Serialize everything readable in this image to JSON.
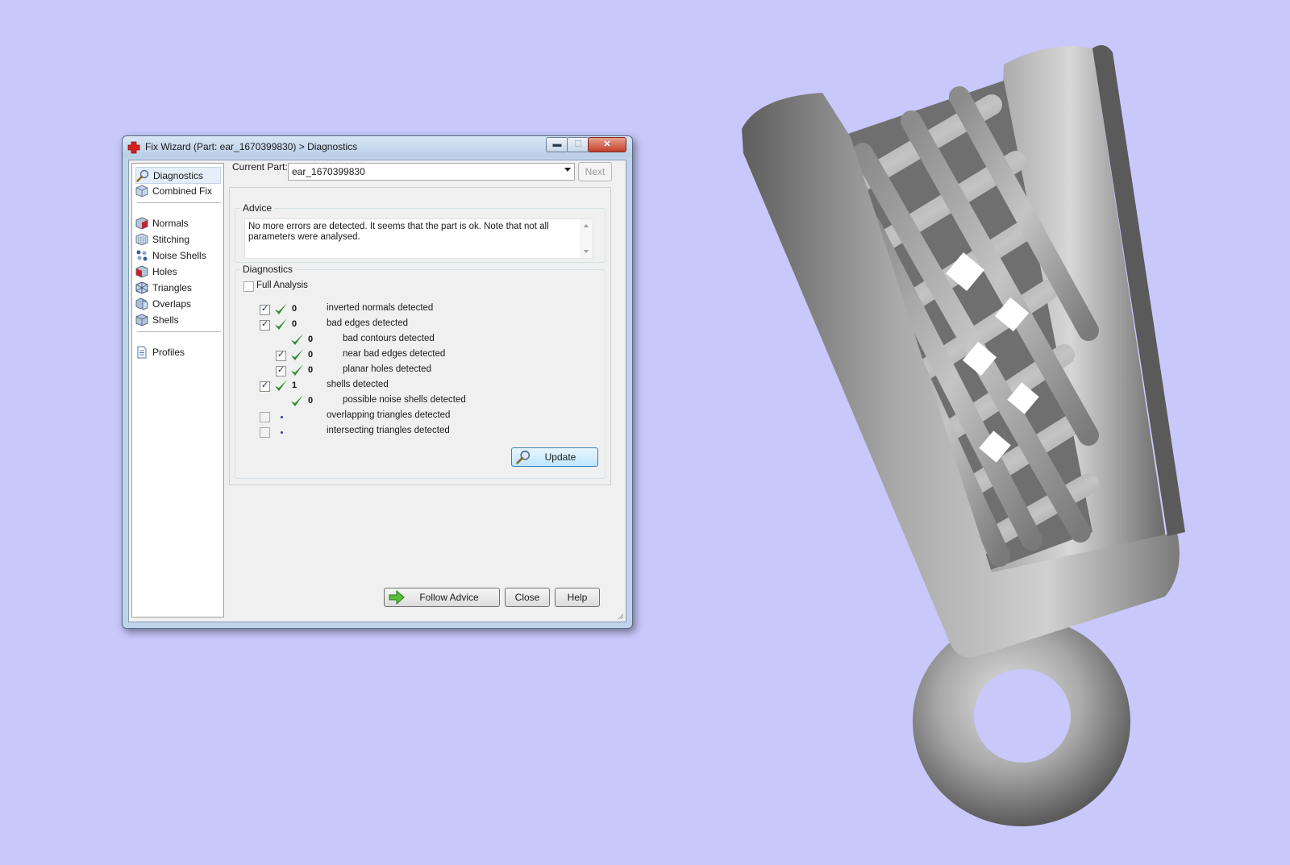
{
  "window": {
    "title": "Fix Wizard (Part: ear_1670399830) > Diagnostics",
    "minimize_glyph": "▬",
    "maximize_glyph": "☐",
    "close_glyph": "✕"
  },
  "sidebar": {
    "items": [
      {
        "label": "Diagnostics",
        "icon": "magnifier-icon",
        "selected": true
      },
      {
        "label": "Combined Fix",
        "icon": "cube-icon"
      },
      {
        "label": "Normals",
        "icon": "normals-cube-icon"
      },
      {
        "label": "Stitching",
        "icon": "stitching-cube-icon"
      },
      {
        "label": "Noise Shells",
        "icon": "noise-shells-icon"
      },
      {
        "label": "Holes",
        "icon": "holes-cube-icon"
      },
      {
        "label": "Triangles",
        "icon": "triangles-cube-icon"
      },
      {
        "label": "Overlaps",
        "icon": "overlaps-cube-icon"
      },
      {
        "label": "Shells",
        "icon": "shells-cube-icon"
      },
      {
        "label": "Profiles",
        "icon": "document-icon"
      }
    ]
  },
  "header": {
    "current_part_label": "Current Part:",
    "current_part_value": "ear_1670399830",
    "next_label": "Next"
  },
  "advice": {
    "title": "Advice",
    "text": "No more errors are detected. It seems that the part is ok. Note that not all parameters were analysed."
  },
  "diagnostics": {
    "title": "Diagnostics",
    "full_analysis_label": "Full Analysis",
    "rows": [
      {
        "checked": true,
        "status": "ok",
        "count": "0",
        "label": "inverted normals detected",
        "indent": 0
      },
      {
        "checked": true,
        "status": "ok",
        "count": "0",
        "label": "bad edges detected",
        "indent": 0
      },
      {
        "checked": null,
        "status": "ok",
        "count": "0",
        "label": "bad contours detected",
        "indent": 1
      },
      {
        "checked": true,
        "status": "ok",
        "count": "0",
        "label": "near bad edges detected",
        "indent": 1
      },
      {
        "checked": true,
        "status": "ok",
        "count": "0",
        "label": "planar holes detected",
        "indent": 1
      },
      {
        "checked": true,
        "status": "ok",
        "count": "1",
        "label": "shells detected",
        "indent": 0
      },
      {
        "checked": null,
        "status": "ok",
        "count": "0",
        "label": "possible noise shells detected",
        "indent": 1
      },
      {
        "checked": false,
        "status": "none",
        "count": "",
        "label": "overlapping triangles detected",
        "indent": 0
      },
      {
        "checked": false,
        "status": "none",
        "count": "",
        "label": "intersecting triangles detected",
        "indent": 0
      }
    ],
    "update_label": "Update"
  },
  "footer": {
    "follow_advice_label": "Follow Advice",
    "close_label": "Close",
    "help_label": "Help"
  },
  "colors": {
    "desktop_bg": "#c8c8fb",
    "check_green": "#2e8b2e",
    "model_gray": "#8a8a8a"
  }
}
